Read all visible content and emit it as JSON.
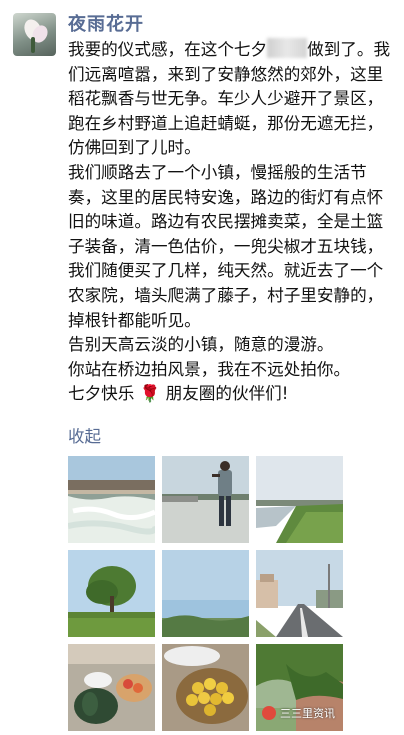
{
  "post": {
    "nickname": "夜雨花开",
    "paragraphs": [
      "我要的仪式感，在这个七夕",
      "做到了。我们远离喧嚣，来到了安静悠然的郊外，这里稻花飘香与世无争。车少人少避开了景区，跑在乡村野道上追赶蜻蜓，那份无遮无拦，仿佛回到了儿时。",
      "我们顺路去了一个小镇，慢摇般的生活节奏，这里的居民特安逸，路边的街灯有点怀旧的味道。路边有农民摆摊卖菜，全是土篮子装备，清一色估价，一兜尖椒才五块钱，我们随便买了几样，纯天然。就近去了一个农家院，墙头爬满了藤子，村子里安静的，掉根针都能听见。",
      "告别天高云淡的小镇，随意的漫游。",
      "你站在桥边拍风景，我在不远处拍你。",
      "七夕快乐",
      "朋友圈的伙伴们!"
    ],
    "rose_emoji": "🌹",
    "collapse_label": "收起"
  },
  "photos": [
    {
      "name": "dam-waterfall-photo"
    },
    {
      "name": "man-on-bridge-photo"
    },
    {
      "name": "river-grass-photo"
    },
    {
      "name": "tree-field-photo"
    },
    {
      "name": "open-sky-photo"
    },
    {
      "name": "town-road-photo"
    },
    {
      "name": "pumpkin-vegetables-photo"
    },
    {
      "name": "fruit-basket-photo"
    },
    {
      "name": "vine-wall-photo"
    }
  ],
  "watermark": {
    "text": "三三里资讯"
  }
}
